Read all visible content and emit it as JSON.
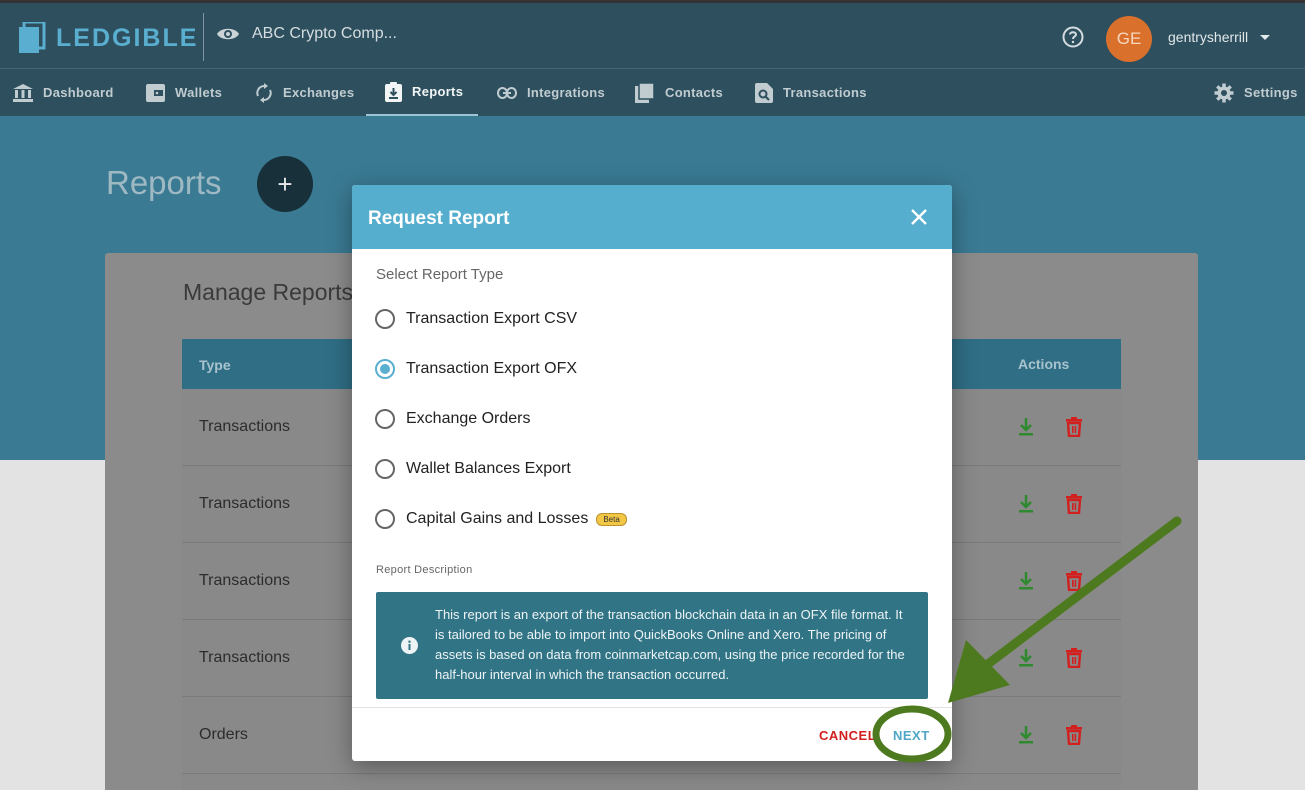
{
  "app": {
    "logo_text": "LEDGIBLE",
    "company_name": "ABC Crypto Comp...",
    "avatar_initials": "GE",
    "username": "gentrysherrill"
  },
  "nav": {
    "items": [
      {
        "label": "Dashboard",
        "icon": "bank-icon"
      },
      {
        "label": "Wallets",
        "icon": "wallet-icon"
      },
      {
        "label": "Exchanges",
        "icon": "sync-icon"
      },
      {
        "label": "Reports",
        "icon": "report-icon",
        "active": true
      },
      {
        "label": "Integrations",
        "icon": "link-icon"
      },
      {
        "label": "Contacts",
        "icon": "contacts-icon"
      },
      {
        "label": "Transactions",
        "icon": "transactions-icon"
      }
    ],
    "settings_label": "Settings"
  },
  "page": {
    "title": "Reports",
    "add_button_label": "+",
    "card_title": "Manage Reports",
    "table": {
      "columns": {
        "type": "Type",
        "actions": "Actions"
      },
      "rows": [
        {
          "type": "Transactions"
        },
        {
          "type": "Transactions"
        },
        {
          "type": "Transactions"
        },
        {
          "type": "Transactions"
        },
        {
          "type": "Orders"
        }
      ]
    }
  },
  "modal": {
    "title": "Request Report",
    "section_label": "Select Report Type",
    "options": [
      {
        "label": "Transaction Export CSV",
        "selected": false
      },
      {
        "label": "Transaction Export OFX",
        "selected": true
      },
      {
        "label": "Exchange Orders",
        "selected": false
      },
      {
        "label": "Wallet Balances Export",
        "selected": false
      },
      {
        "label": "Capital Gains and Losses",
        "selected": false,
        "badge": "Beta"
      }
    ],
    "description_label": "Report Description",
    "description": "This report is an export of the transaction blockchain data in an OFX file format. It is tailored to be able to import into QuickBooks Online and Xero. The pricing of assets is based on data from coinmarketcap.com, using the price recorded for the half-hour interval in which the transaction occurred.",
    "cancel_label": "CANCEL",
    "next_label": "NEXT"
  },
  "colors": {
    "header_bg": "#2d4f5e",
    "accent": "#56aece",
    "download_green": "#2f8a2f",
    "delete_red": "#d2201f",
    "annotation_green": "#4e7a1f"
  }
}
